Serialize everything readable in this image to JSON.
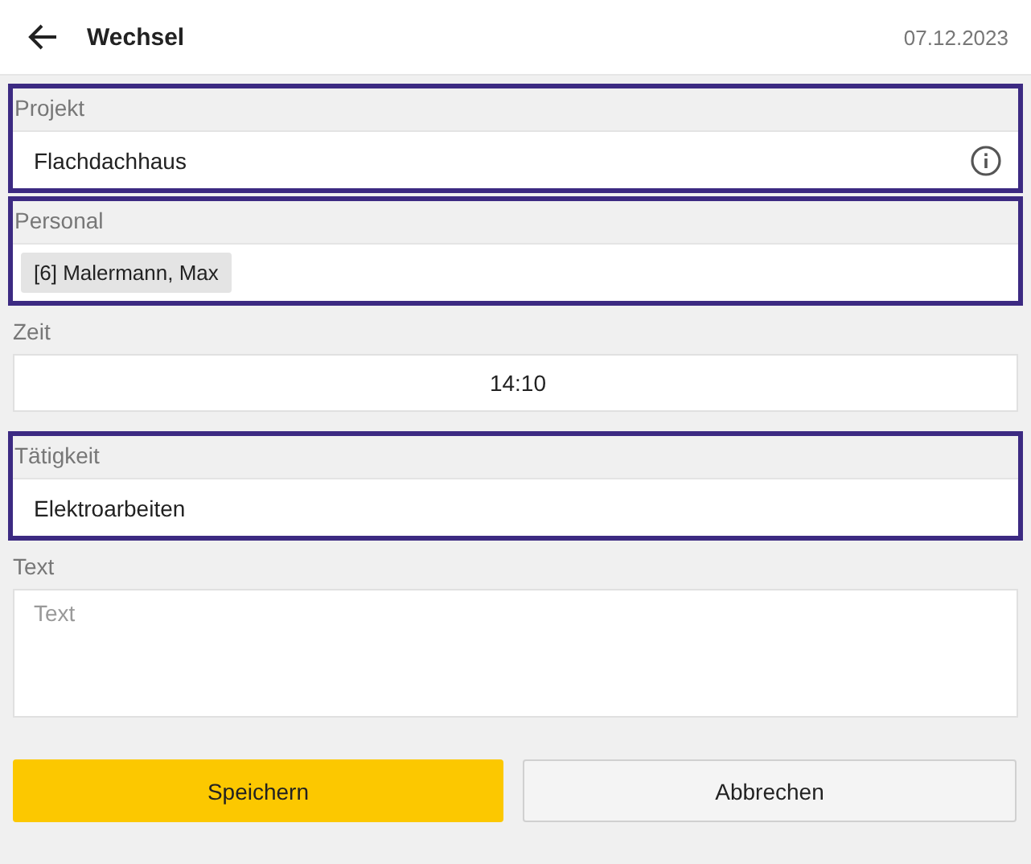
{
  "header": {
    "title": "Wechsel",
    "date": "07.12.2023"
  },
  "fields": [
    {
      "kind": "text",
      "label": "Projekt",
      "value": "Flachdachhaus",
      "highlighted": true,
      "info": true
    },
    {
      "kind": "chips",
      "label": "Personal",
      "chips": [
        "[6] Malermann, Max"
      ],
      "highlighted": true
    },
    {
      "kind": "time",
      "label": "Zeit",
      "value": "14:10",
      "highlighted": false
    },
    {
      "kind": "text",
      "label": "Tätigkeit",
      "value": "Elektroarbeiten",
      "highlighted": true,
      "info": false
    },
    {
      "kind": "textarea",
      "label": "Text",
      "placeholder": "Text",
      "highlighted": false
    }
  ],
  "buttons": [
    {
      "label": "Speichern",
      "kind": "primary"
    },
    {
      "label": "Abbrechen",
      "kind": "secondary"
    }
  ]
}
